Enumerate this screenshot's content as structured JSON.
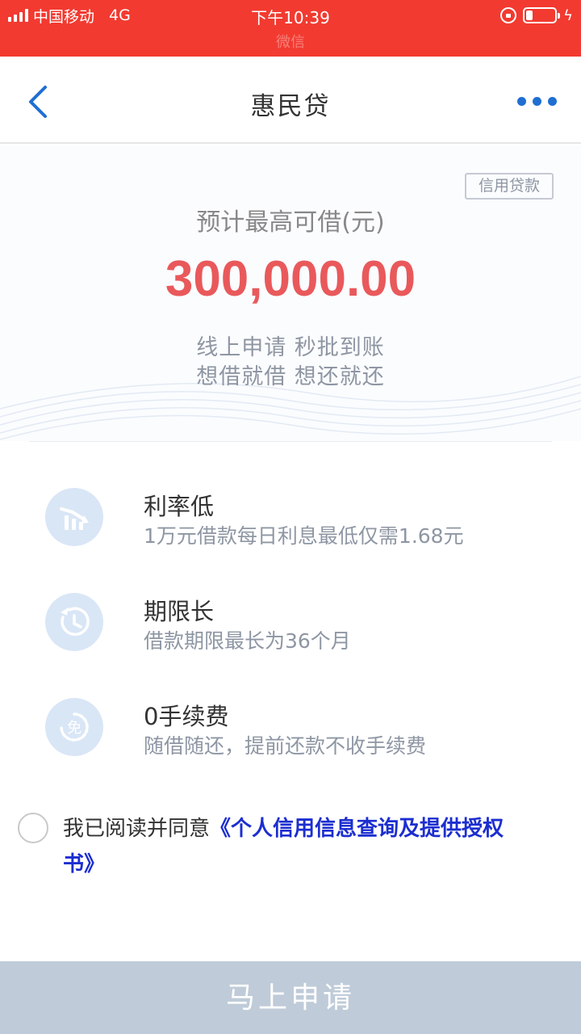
{
  "status_bar": {
    "carrier": "中国移动",
    "network": "4G",
    "time": "下午10:39",
    "sub_label": "微信"
  },
  "nav": {
    "title": "惠民贷"
  },
  "hero": {
    "tag": "信用贷款",
    "label": "预计最高可借(元)",
    "amount": "300,000.00",
    "slogan_line1": "线上申请  秒批到账",
    "slogan_line2": "想借就借  想还就还"
  },
  "features": [
    {
      "icon": "low-rate-icon",
      "title": "利率低",
      "desc": "1万元借款每日利息最低仅需1.68元"
    },
    {
      "icon": "clock-icon",
      "title": "期限长",
      "desc": "借款期限最长为36个月"
    },
    {
      "icon": "free-fee-icon",
      "title": "0手续费",
      "desc": "随借随还，提前还款不收手续费"
    }
  ],
  "agreement": {
    "prefix": "我已阅读并同意",
    "link": "《个人信用信息查询及提供授权书》"
  },
  "apply_button": {
    "label": "马上申请"
  },
  "colors": {
    "status_bar": "#f23a30",
    "amount": "#e9595b",
    "accent_blue": "#1f6fd1",
    "link": "#1c2ed0",
    "button_disabled": "#bfcbd8",
    "icon_bg": "#d9e6f6"
  }
}
